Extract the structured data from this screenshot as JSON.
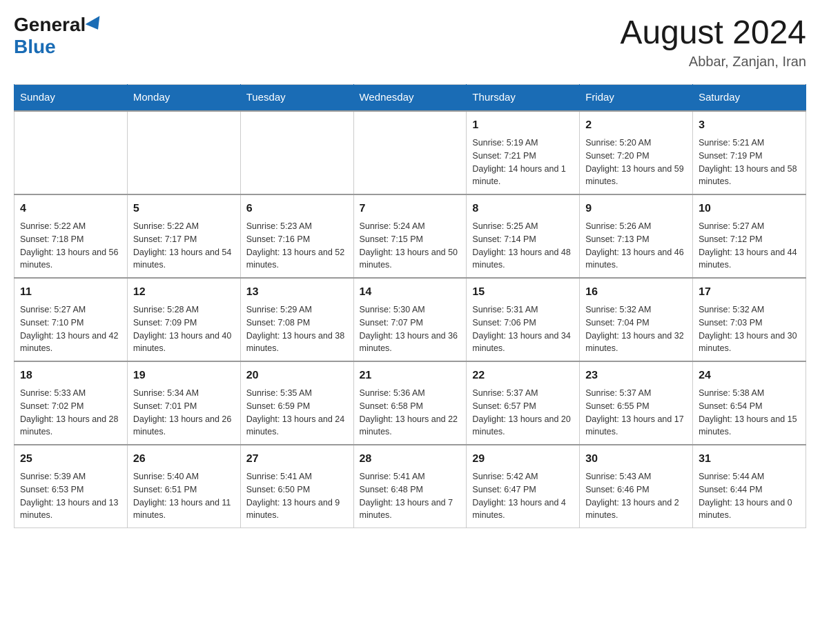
{
  "logo": {
    "general": "General",
    "blue": "Blue"
  },
  "title": {
    "month_year": "August 2024",
    "location": "Abbar, Zanjan, Iran"
  },
  "days_of_week": [
    "Sunday",
    "Monday",
    "Tuesday",
    "Wednesday",
    "Thursday",
    "Friday",
    "Saturday"
  ],
  "weeks": [
    [
      {
        "day": "",
        "sunrise": "",
        "sunset": "",
        "daylight": ""
      },
      {
        "day": "",
        "sunrise": "",
        "sunset": "",
        "daylight": ""
      },
      {
        "day": "",
        "sunrise": "",
        "sunset": "",
        "daylight": ""
      },
      {
        "day": "",
        "sunrise": "",
        "sunset": "",
        "daylight": ""
      },
      {
        "day": "1",
        "sunrise": "Sunrise: 5:19 AM",
        "sunset": "Sunset: 7:21 PM",
        "daylight": "Daylight: 14 hours and 1 minute."
      },
      {
        "day": "2",
        "sunrise": "Sunrise: 5:20 AM",
        "sunset": "Sunset: 7:20 PM",
        "daylight": "Daylight: 13 hours and 59 minutes."
      },
      {
        "day": "3",
        "sunrise": "Sunrise: 5:21 AM",
        "sunset": "Sunset: 7:19 PM",
        "daylight": "Daylight: 13 hours and 58 minutes."
      }
    ],
    [
      {
        "day": "4",
        "sunrise": "Sunrise: 5:22 AM",
        "sunset": "Sunset: 7:18 PM",
        "daylight": "Daylight: 13 hours and 56 minutes."
      },
      {
        "day": "5",
        "sunrise": "Sunrise: 5:22 AM",
        "sunset": "Sunset: 7:17 PM",
        "daylight": "Daylight: 13 hours and 54 minutes."
      },
      {
        "day": "6",
        "sunrise": "Sunrise: 5:23 AM",
        "sunset": "Sunset: 7:16 PM",
        "daylight": "Daylight: 13 hours and 52 minutes."
      },
      {
        "day": "7",
        "sunrise": "Sunrise: 5:24 AM",
        "sunset": "Sunset: 7:15 PM",
        "daylight": "Daylight: 13 hours and 50 minutes."
      },
      {
        "day": "8",
        "sunrise": "Sunrise: 5:25 AM",
        "sunset": "Sunset: 7:14 PM",
        "daylight": "Daylight: 13 hours and 48 minutes."
      },
      {
        "day": "9",
        "sunrise": "Sunrise: 5:26 AM",
        "sunset": "Sunset: 7:13 PM",
        "daylight": "Daylight: 13 hours and 46 minutes."
      },
      {
        "day": "10",
        "sunrise": "Sunrise: 5:27 AM",
        "sunset": "Sunset: 7:12 PM",
        "daylight": "Daylight: 13 hours and 44 minutes."
      }
    ],
    [
      {
        "day": "11",
        "sunrise": "Sunrise: 5:27 AM",
        "sunset": "Sunset: 7:10 PM",
        "daylight": "Daylight: 13 hours and 42 minutes."
      },
      {
        "day": "12",
        "sunrise": "Sunrise: 5:28 AM",
        "sunset": "Sunset: 7:09 PM",
        "daylight": "Daylight: 13 hours and 40 minutes."
      },
      {
        "day": "13",
        "sunrise": "Sunrise: 5:29 AM",
        "sunset": "Sunset: 7:08 PM",
        "daylight": "Daylight: 13 hours and 38 minutes."
      },
      {
        "day": "14",
        "sunrise": "Sunrise: 5:30 AM",
        "sunset": "Sunset: 7:07 PM",
        "daylight": "Daylight: 13 hours and 36 minutes."
      },
      {
        "day": "15",
        "sunrise": "Sunrise: 5:31 AM",
        "sunset": "Sunset: 7:06 PM",
        "daylight": "Daylight: 13 hours and 34 minutes."
      },
      {
        "day": "16",
        "sunrise": "Sunrise: 5:32 AM",
        "sunset": "Sunset: 7:04 PM",
        "daylight": "Daylight: 13 hours and 32 minutes."
      },
      {
        "day": "17",
        "sunrise": "Sunrise: 5:32 AM",
        "sunset": "Sunset: 7:03 PM",
        "daylight": "Daylight: 13 hours and 30 minutes."
      }
    ],
    [
      {
        "day": "18",
        "sunrise": "Sunrise: 5:33 AM",
        "sunset": "Sunset: 7:02 PM",
        "daylight": "Daylight: 13 hours and 28 minutes."
      },
      {
        "day": "19",
        "sunrise": "Sunrise: 5:34 AM",
        "sunset": "Sunset: 7:01 PM",
        "daylight": "Daylight: 13 hours and 26 minutes."
      },
      {
        "day": "20",
        "sunrise": "Sunrise: 5:35 AM",
        "sunset": "Sunset: 6:59 PM",
        "daylight": "Daylight: 13 hours and 24 minutes."
      },
      {
        "day": "21",
        "sunrise": "Sunrise: 5:36 AM",
        "sunset": "Sunset: 6:58 PM",
        "daylight": "Daylight: 13 hours and 22 minutes."
      },
      {
        "day": "22",
        "sunrise": "Sunrise: 5:37 AM",
        "sunset": "Sunset: 6:57 PM",
        "daylight": "Daylight: 13 hours and 20 minutes."
      },
      {
        "day": "23",
        "sunrise": "Sunrise: 5:37 AM",
        "sunset": "Sunset: 6:55 PM",
        "daylight": "Daylight: 13 hours and 17 minutes."
      },
      {
        "day": "24",
        "sunrise": "Sunrise: 5:38 AM",
        "sunset": "Sunset: 6:54 PM",
        "daylight": "Daylight: 13 hours and 15 minutes."
      }
    ],
    [
      {
        "day": "25",
        "sunrise": "Sunrise: 5:39 AM",
        "sunset": "Sunset: 6:53 PM",
        "daylight": "Daylight: 13 hours and 13 minutes."
      },
      {
        "day": "26",
        "sunrise": "Sunrise: 5:40 AM",
        "sunset": "Sunset: 6:51 PM",
        "daylight": "Daylight: 13 hours and 11 minutes."
      },
      {
        "day": "27",
        "sunrise": "Sunrise: 5:41 AM",
        "sunset": "Sunset: 6:50 PM",
        "daylight": "Daylight: 13 hours and 9 minutes."
      },
      {
        "day": "28",
        "sunrise": "Sunrise: 5:41 AM",
        "sunset": "Sunset: 6:48 PM",
        "daylight": "Daylight: 13 hours and 7 minutes."
      },
      {
        "day": "29",
        "sunrise": "Sunrise: 5:42 AM",
        "sunset": "Sunset: 6:47 PM",
        "daylight": "Daylight: 13 hours and 4 minutes."
      },
      {
        "day": "30",
        "sunrise": "Sunrise: 5:43 AM",
        "sunset": "Sunset: 6:46 PM",
        "daylight": "Daylight: 13 hours and 2 minutes."
      },
      {
        "day": "31",
        "sunrise": "Sunrise: 5:44 AM",
        "sunset": "Sunset: 6:44 PM",
        "daylight": "Daylight: 13 hours and 0 minutes."
      }
    ]
  ]
}
